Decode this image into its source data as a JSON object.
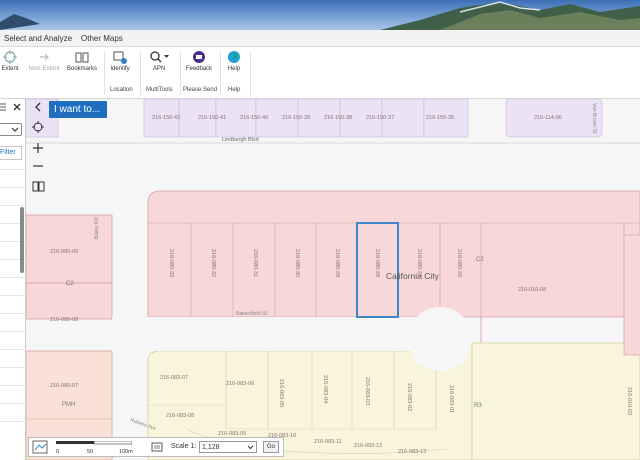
{
  "menu": {
    "items": [
      "Select and Analyze",
      "Other Maps"
    ]
  },
  "ribbon": {
    "buttons": [
      {
        "label": "Extent",
        "enabled": true,
        "icon": "zoom-extent-icon"
      },
      {
        "label": "Next Extent",
        "enabled": false,
        "icon": "next-extent-icon"
      },
      {
        "label": "Bookmarks",
        "enabled": true,
        "icon": "book-icon"
      },
      {
        "label": "Identify",
        "enabled": true,
        "icon": "identify-icon"
      },
      {
        "label": "APN",
        "enabled": true,
        "icon": "search-icon"
      },
      {
        "label": "Feedback",
        "enabled": true,
        "icon": "feedback-icon"
      },
      {
        "label": "Help",
        "enabled": true,
        "icon": "help-icon"
      }
    ],
    "groups": [
      "Location",
      "MultiTools",
      "Please Send",
      "Help"
    ]
  },
  "side": {
    "filter_label": "Filter"
  },
  "iwant": {
    "label": "I want to..."
  },
  "map": {
    "city_label": "California City",
    "streets": {
      "lindbergh": "Lindbergh Blvd",
      "rubens": "Rubens Ave",
      "bakersfield": "Bakersfield St",
      "bailey": "Bailey Rd",
      "brown": "Van Brown St"
    },
    "zone_labels": {
      "r": "R3",
      "c2a": "C2",
      "c2b": "C2",
      "pmh": "PMH"
    },
    "parcels": {
      "p1": "216-150-42",
      "p2": "216-150-41",
      "p3": "216-150-40",
      "p4": "216-150-39",
      "p5": "216-150-38",
      "p6": "216-150-37",
      "p7": "216-150-36",
      "p8": "216-114-06",
      "p9": "216-080-09",
      "p10": "216-080-08",
      "p11": "216-080-07",
      "p12": "216-080-33",
      "p13": "216-080-32",
      "p14": "216-080-31",
      "p15": "216-080-30",
      "p16": "216-080-29",
      "p17": "216-080-28",
      "p18": "216-080-27",
      "p19": "216-080-26",
      "p20": "216-010-08",
      "p21": "216-083-07",
      "p22": "216-083-06",
      "p23": "216-083-05",
      "p24": "216-083-04",
      "p25": "216-083-03",
      "p26": "216-083-02",
      "p27": "216-083-01",
      "p28": "216-083-08",
      "p29": "216-083-09",
      "p30": "216-083-10",
      "p31": "216-083-11",
      "p32": "216-083-12",
      "p33": "216-083-13",
      "p34": "216-010-02"
    }
  },
  "scale": {
    "ticks": [
      "0",
      "50",
      "100m"
    ],
    "label": "Scale 1:",
    "value": "1,128",
    "go": "Go"
  },
  "colors": {
    "commercial": "#f7d7d8",
    "residential": "#f8f5dc",
    "mobilehome": "#f9e1d7",
    "purple": "#ece2f5",
    "selection": "#3d86c9",
    "parcel_line": "#d6a0a0"
  }
}
